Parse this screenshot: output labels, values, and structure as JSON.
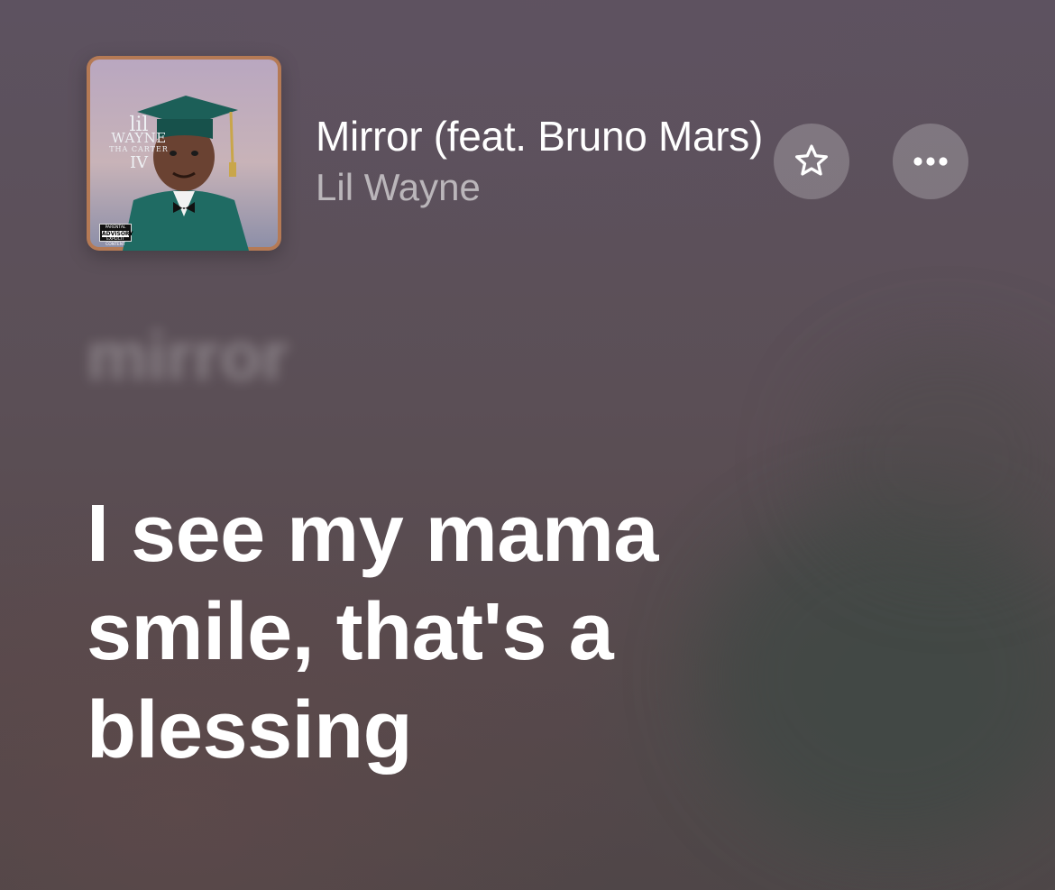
{
  "track": {
    "title": "Mirror (feat. Bruno Mars)",
    "artist": "Lil Wayne"
  },
  "album_art": {
    "artist_line1": "lil",
    "artist_line2": "WAYNE",
    "album_line": "THA CARTER",
    "album_number": "IV",
    "advisory_top": "PARENTAL",
    "advisory_mid": "ADVISORY",
    "advisory_bottom": "EXPLICIT CONTENT"
  },
  "actions": {
    "favorite_icon": "star-icon",
    "more_icon": "ellipsis-icon"
  },
  "lyrics": {
    "previous_line": "mirror",
    "current_lines": [
      "I see my mama",
      "smile, that's a",
      "blessing"
    ]
  },
  "colors": {
    "background": "#5a4d55",
    "text_primary": "#ffffff",
    "text_secondary": "rgba(255,255,255,0.58)",
    "button_fill": "rgba(255,255,255,0.22)"
  }
}
